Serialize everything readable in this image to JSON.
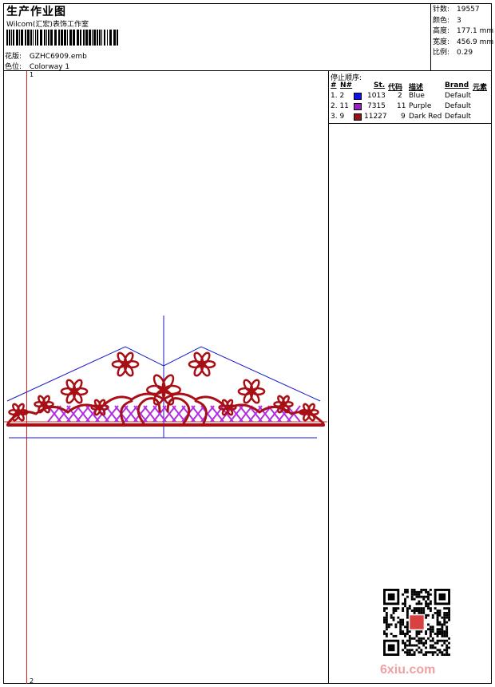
{
  "header": {
    "title": "生产作业图",
    "company": "Wilcom(汇宏)表饰工作室",
    "pattern_label": "花版:",
    "pattern_value": "GZHC6909.emb",
    "colorway_label": "色位:",
    "colorway_value": "Colorway 1"
  },
  "specs": [
    {
      "label": "针数:",
      "value": "19557"
    },
    {
      "label": "颜色:",
      "value": "3"
    },
    {
      "label": "高度:",
      "value": "177.1 mm"
    },
    {
      "label": "宽度:",
      "value": "456.9 mm"
    },
    {
      "label": "比例:",
      "value": "0.29"
    }
  ],
  "stop_sequence": {
    "title": "停止顺序:",
    "columns": {
      "hash": "#",
      "no": "N#",
      "st": "St.",
      "code": "代码",
      "desc": "描述",
      "brand": "Brand",
      "element": "元素"
    },
    "rows": [
      {
        "idx": "1. 2",
        "color": "#1010ee",
        "st": "1013",
        "code": "2",
        "desc": "Blue",
        "brand": "Default"
      },
      {
        "idx": "2. 11",
        "color": "#9a1fc2",
        "st": "7315",
        "code": "11",
        "desc": "Purple",
        "brand": "Default"
      },
      {
        "idx": "3. 9",
        "color": "#9a0f14",
        "st": "11227",
        "code": "9",
        "desc": "Dark Red",
        "brand": "Default"
      }
    ]
  },
  "markers": {
    "top": "1",
    "bottom": "2"
  },
  "watermark": "6xiu.com",
  "colors": {
    "design_red": "#a80f14",
    "lattice_purple": "#b030e0",
    "guide_blue": "#1a1acc",
    "guide_red": "#e02020"
  }
}
